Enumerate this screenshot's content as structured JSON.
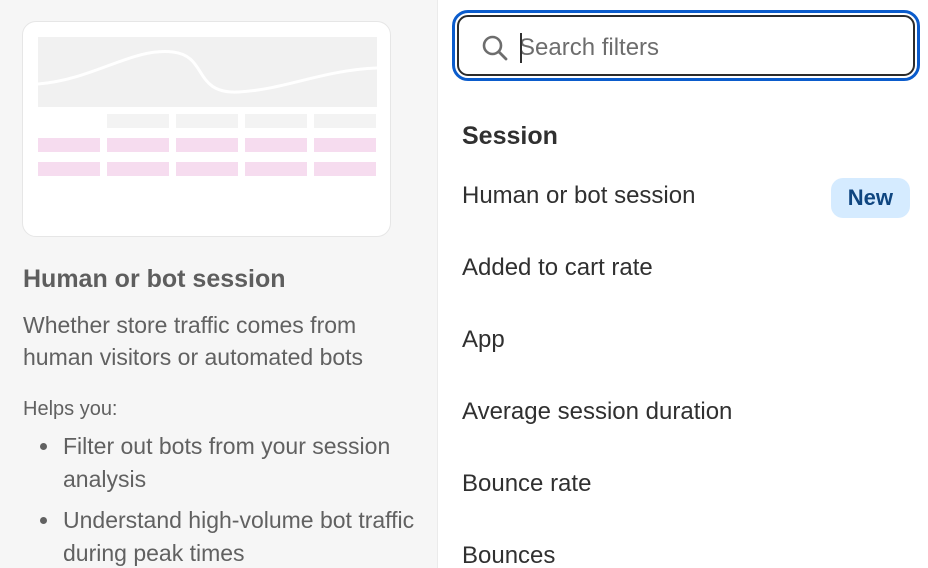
{
  "preview": {
    "colors": {
      "chart_bg": "#f1f1f1",
      "line": "#ffffff",
      "header_cell": "#f3f3f3",
      "pink_row": "#f6dcef"
    }
  },
  "detail": {
    "title": "Human or bot session",
    "description": "Whether store traffic comes from human visitors or automated bots",
    "helps_label": "Helps you:",
    "benefits": [
      "Filter out bots from your session analysis",
      "Understand high-volume bot traffic during peak times"
    ]
  },
  "search": {
    "placeholder": "Search filters",
    "value": "",
    "icon": "search-icon"
  },
  "filters": {
    "section_title": "Session",
    "items": [
      {
        "label": "Human or bot session",
        "badge": "New"
      },
      {
        "label": "Added to cart rate"
      },
      {
        "label": "App"
      },
      {
        "label": "Average session duration"
      },
      {
        "label": "Bounce rate"
      },
      {
        "label": "Bounces"
      }
    ]
  },
  "colors": {
    "focus_ring": "#0b5ccc",
    "badge_bg": "#d5ebff",
    "badge_text": "#0f4680",
    "left_pane_bg": "#f6f6f6"
  }
}
